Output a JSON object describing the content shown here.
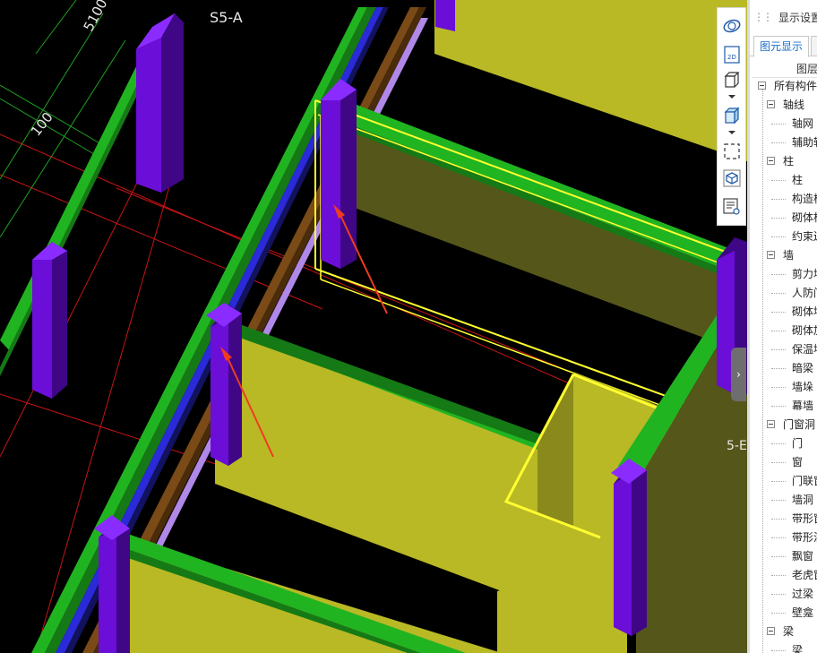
{
  "viewport": {
    "axis_labels": {
      "top": "S5-A",
      "right": "5-E"
    },
    "dimension_labels": {
      "top": "5100",
      "left": "100"
    }
  },
  "toolbar": {
    "buttons": [
      {
        "id": "orbit-icon"
      },
      {
        "id": "view-2d-icon",
        "label": "2D"
      },
      {
        "id": "wireframe-cube-icon"
      },
      {
        "id": "solid-cube-icon"
      },
      {
        "id": "select-frame-icon"
      },
      {
        "id": "component-cube-icon"
      },
      {
        "id": "display-list-icon"
      }
    ]
  },
  "panel": {
    "title": "显示设置",
    "tab_active": "图元显示",
    "column_header": "图层",
    "tree": [
      {
        "label": "所有构件",
        "level": 0,
        "expandable": true
      },
      {
        "label": "轴线",
        "level": 1,
        "expandable": true
      },
      {
        "label": "轴网",
        "level": 2
      },
      {
        "label": "辅助轴",
        "level": 2
      },
      {
        "label": "柱",
        "level": 1,
        "expandable": true
      },
      {
        "label": "柱",
        "level": 2
      },
      {
        "label": "构造柱",
        "level": 2
      },
      {
        "label": "砌体柱",
        "level": 2
      },
      {
        "label": "约束边",
        "level": 2
      },
      {
        "label": "墙",
        "level": 1,
        "expandable": true
      },
      {
        "label": "剪力墙",
        "level": 2
      },
      {
        "label": "人防门",
        "level": 2
      },
      {
        "label": "砌体墙",
        "level": 2
      },
      {
        "label": "砌体加",
        "level": 2
      },
      {
        "label": "保温墙",
        "level": 2
      },
      {
        "label": "暗梁",
        "level": 2
      },
      {
        "label": "墙垛",
        "level": 2
      },
      {
        "label": "幕墙",
        "level": 2
      },
      {
        "label": "门窗洞",
        "level": 1,
        "expandable": true
      },
      {
        "label": "门",
        "level": 2
      },
      {
        "label": "窗",
        "level": 2
      },
      {
        "label": "门联窗",
        "level": 2
      },
      {
        "label": "墙洞",
        "level": 2
      },
      {
        "label": "带形窗",
        "level": 2
      },
      {
        "label": "带形洞",
        "level": 2
      },
      {
        "label": "飘窗",
        "level": 2
      },
      {
        "label": "老虎窗",
        "level": 2
      },
      {
        "label": "过梁",
        "level": 2
      },
      {
        "label": "壁龛",
        "level": 2
      },
      {
        "label": "梁",
        "level": 1,
        "expandable": true
      },
      {
        "label": "梁",
        "level": 2
      }
    ]
  },
  "colors": {
    "wall_yellow": "#b9b926",
    "wall_dark": "#55561a",
    "beam_green": "#21b421",
    "column_purple": "#6b0ed8",
    "column_purple_dark": "#3f0786",
    "lintel_brown": "#7a4a17",
    "strip_blue": "#2a2ad8",
    "selection_yellow": "#ffff30",
    "arrow_red": "#f03c1e",
    "axis_red": "#d81010"
  }
}
